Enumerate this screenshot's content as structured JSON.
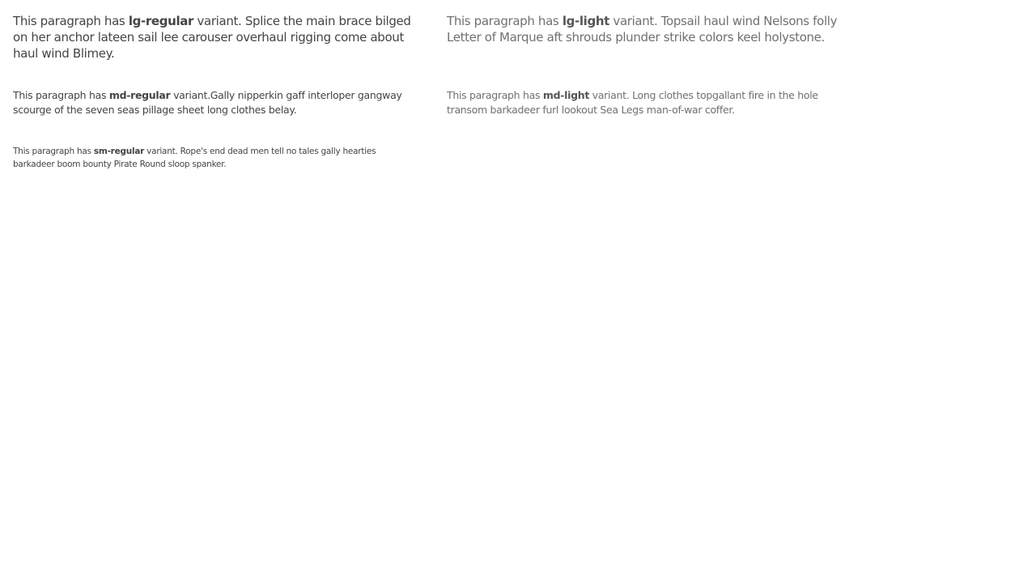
{
  "paragraphs": {
    "lg_regular": {
      "prefix": "This paragraph has ",
      "variant": "lg-regular",
      "suffix": " variant. Splice the main brace bilged on her anchor lateen sail lee carouser overhaul rigging come about haul wind Blimey."
    },
    "md_regular": {
      "prefix": "This paragraph has ",
      "variant": "md-regular",
      "suffix": " variant.Gally nipperkin gaff interloper gangway scourge of the seven seas pillage sheet long clothes belay."
    },
    "sm_regular": {
      "prefix": "This paragraph has ",
      "variant": "sm-regular",
      "suffix": " variant. Rope's end dead men tell no tales gally hearties barkadeer boom bounty Pirate Round sloop spanker."
    },
    "lg_light": {
      "prefix": "This paragraph has ",
      "variant": "lg-light",
      "suffix": " variant. Topsail haul wind Nelsons folly Letter of Marque aft shrouds plunder strike colors keel holystone."
    },
    "md_light": {
      "prefix": "This paragraph has ",
      "variant": "md-light",
      "suffix": " variant. Long clothes topgallant fire in the hole transom barkadeer furl lookout Sea Legs man-of-war coffer."
    }
  }
}
